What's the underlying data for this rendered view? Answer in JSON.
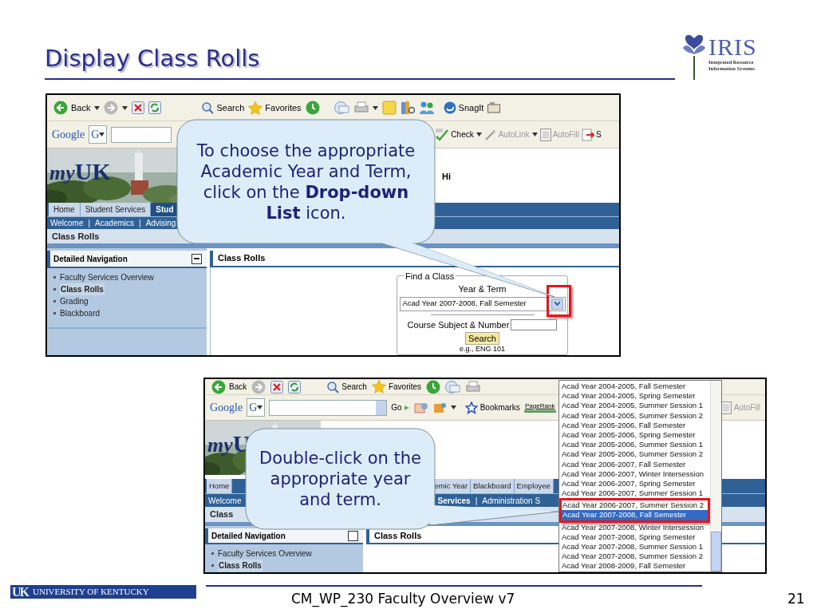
{
  "slide": {
    "title": "Display Class Rolls"
  },
  "logo": {
    "name": "IRIS",
    "tagline": [
      "Integrated Resource",
      "Information Systems"
    ]
  },
  "screenshots": [
    {
      "toolbar": {
        "back": "Back",
        "search": "Search",
        "favorites": "Favorites",
        "snagit": "SnagIt"
      },
      "google_bar": {
        "brand": "Google",
        "g_button": "G",
        "check": "Check",
        "autolink": "AutoLink",
        "autofill": "AutoFill",
        "cut_item": "S"
      },
      "portal": {
        "brand_my": "my",
        "brand_uk": "UK",
        "greeting": "Hi"
      },
      "tabs": [
        {
          "label": "Home",
          "selected": false
        },
        {
          "label": "Student Services",
          "selected": false
        },
        {
          "label": "Stud",
          "selected": true
        }
      ],
      "subnav": [
        {
          "label": "Welcome",
          "selected": false
        },
        {
          "label": "|",
          "selected": false
        },
        {
          "label": "Academics",
          "selected": false
        },
        {
          "label": "|",
          "selected": false
        },
        {
          "label": "Advising",
          "selected": false
        }
      ],
      "page_title": "Class Rolls",
      "nav": {
        "header": "Detailed Navigation",
        "items": [
          {
            "label": "Faculty Services Overview",
            "selected": false
          },
          {
            "label": "Class Rolls",
            "selected": true
          },
          {
            "label": "Grading",
            "selected": false
          },
          {
            "label": "Blackboard",
            "selected": false
          }
        ]
      },
      "content_header": "Class Rolls",
      "find_class": {
        "legend": "Find a Class",
        "year_label": "Year & Term",
        "select_value": "Acad Year 2007-2008, Fall Semester",
        "course_label": "Course Subject & Number",
        "search_button": "Search",
        "example": "e.g., ENG 101"
      }
    },
    {
      "toolbar": {
        "back": "Back",
        "search": "Search",
        "favorites": "Favorites"
      },
      "google_bar": {
        "brand": "Google",
        "g_button": "G",
        "go": "Go",
        "bookmarks": "Bookmarks",
        "pagerank": "PageRank",
        "autofill": "AutoFill"
      },
      "portal": {
        "brand_my": "my",
        "brand_uk": "U"
      },
      "tabs": [
        {
          "label": "Home",
          "selected": false
        },
        {
          "label": "emic Year",
          "selected": false
        },
        {
          "label": "Blackboard",
          "selected": false
        },
        {
          "label": "Employee",
          "selected": false
        }
      ],
      "subnav": [
        {
          "label": "Welcome",
          "selected": false
        },
        {
          "label": "Services",
          "selected": true
        },
        {
          "label": "|",
          "selected": false
        },
        {
          "label": "Administration S",
          "selected": false
        }
      ],
      "page_title": "Class",
      "nav": {
        "header": "Detailed Navigation",
        "items": [
          {
            "label": "Faculty Services Overview",
            "selected": false
          },
          {
            "label": "Class Rolls",
            "selected": true
          }
        ]
      },
      "content_header": "Class Rolls",
      "dropdown": {
        "options": [
          {
            "label": "Acad Year 2004-2005, Fall Semester",
            "selected": false
          },
          {
            "label": "Acad Year 2004-2005, Spring Semester",
            "selected": false
          },
          {
            "label": "Acad Year 2004-2005, Summer Session 1",
            "selected": false
          },
          {
            "label": "Acad Year 2004-2005, Summer Session 2",
            "selected": false
          },
          {
            "label": "Acad Year 2005-2006, Fall Semester",
            "selected": false
          },
          {
            "label": "Acad Year 2005-2006, Spring Semester",
            "selected": false
          },
          {
            "label": "Acad Year 2005-2006, Summer Session 1",
            "selected": false
          },
          {
            "label": "Acad Year 2005-2006, Summer Session 2",
            "selected": false
          },
          {
            "label": "Acad Year 2006-2007, Fall Semester",
            "selected": false
          },
          {
            "label": "Acad Year 2006-2007, Winter Intersession",
            "selected": false
          },
          {
            "label": "Acad Year 2006-2007, Spring Semester",
            "selected": false
          },
          {
            "label": "Acad Year 2006-2007, Summer Session 1",
            "selected": false
          },
          {
            "label": "Acad Year 2006-2007, Summer Session 2",
            "selected": false
          },
          {
            "label": "Acad Year 2007-2008, Fall Semester",
            "selected": true
          },
          {
            "label": "Acad Year 2007-2008, Winter Intersession",
            "selected": false
          },
          {
            "label": "Acad Year 2007-2008, Spring Semester",
            "selected": false
          },
          {
            "label": "Acad Year 2007-2008, Summer Session 1",
            "selected": false
          },
          {
            "label": "Acad Year 2007-2008, Summer Session 2",
            "selected": false
          },
          {
            "label": "Acad Year 2008-2009, Fall Semester",
            "selected": false
          }
        ]
      }
    }
  ],
  "callouts": [
    "To choose the appropriate Academic Year and Term, click on the **Drop-down List** icon.",
    "Double-click on the appropriate year and term."
  ],
  "footer": {
    "logo_letters": "UK",
    "logo_text": "UNIVERSITY OF KENTUCKY",
    "document": "CM_WP_230 Faculty Overview v7",
    "page": "21"
  }
}
